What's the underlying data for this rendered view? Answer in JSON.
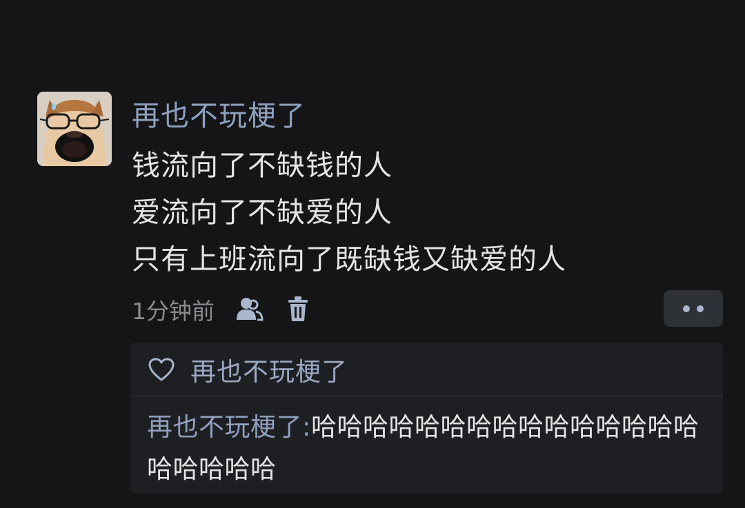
{
  "post": {
    "username": "再也不玩梗了",
    "lines": [
      "钱流向了不缺钱的人",
      "爱流向了不缺爱的人",
      "只有上班流向了既缺钱又缺爱的人"
    ],
    "timestamp": "1分钟前",
    "avatar_icon": "dog-with-glasses-avatar",
    "meta_icons": [
      "people-icon",
      "trash-icon"
    ],
    "more_icon": "more-dots-icon"
  },
  "reply_box": {
    "like_icon": "heart-outline-icon",
    "liked_by": "再也不玩梗了",
    "reply": {
      "author": "再也不玩梗了:",
      "text": "哈哈哈哈哈哈哈哈哈哈哈哈哈哈哈哈哈哈哈哈"
    }
  },
  "colors": {
    "background": "#151517",
    "username": "#8fa0bf",
    "text": "#e4e4e6",
    "muted": "#8a8a8f",
    "panel": "#1e1f23"
  }
}
